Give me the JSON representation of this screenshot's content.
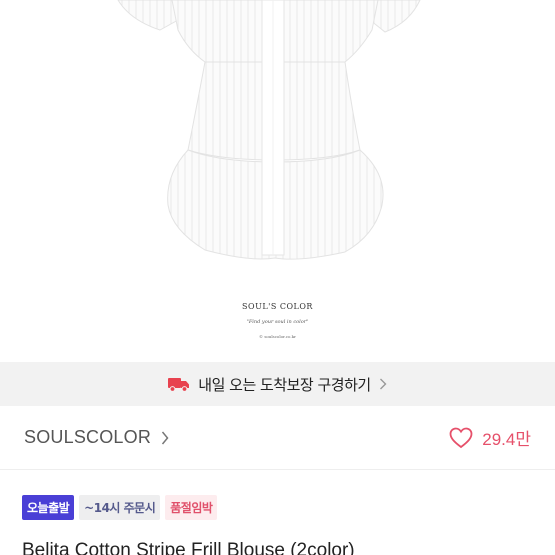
{
  "product_image": {
    "brand": "SOUL'S COLOR",
    "slogan": "\"Find your soul in color\"",
    "site": "© soulscolor.co.kr"
  },
  "delivery_banner": {
    "text": "내일 오는 도착보장 구경하기",
    "icon": "truck-icon"
  },
  "shop": {
    "name": "SOULSCOLOR",
    "likes": "29.4만",
    "heart_color": "#e6506a"
  },
  "tags": [
    {
      "label": "오늘출발"
    },
    {
      "label": "~14시 주문시"
    },
    {
      "label": "품절임박"
    }
  ],
  "product": {
    "title": "Belita Cotton Stripe Frill Blouse (2color)"
  },
  "colors": {
    "accent": "#4a3fd6",
    "like": "#e6506a",
    "banner_bg": "#f2f2f2"
  }
}
